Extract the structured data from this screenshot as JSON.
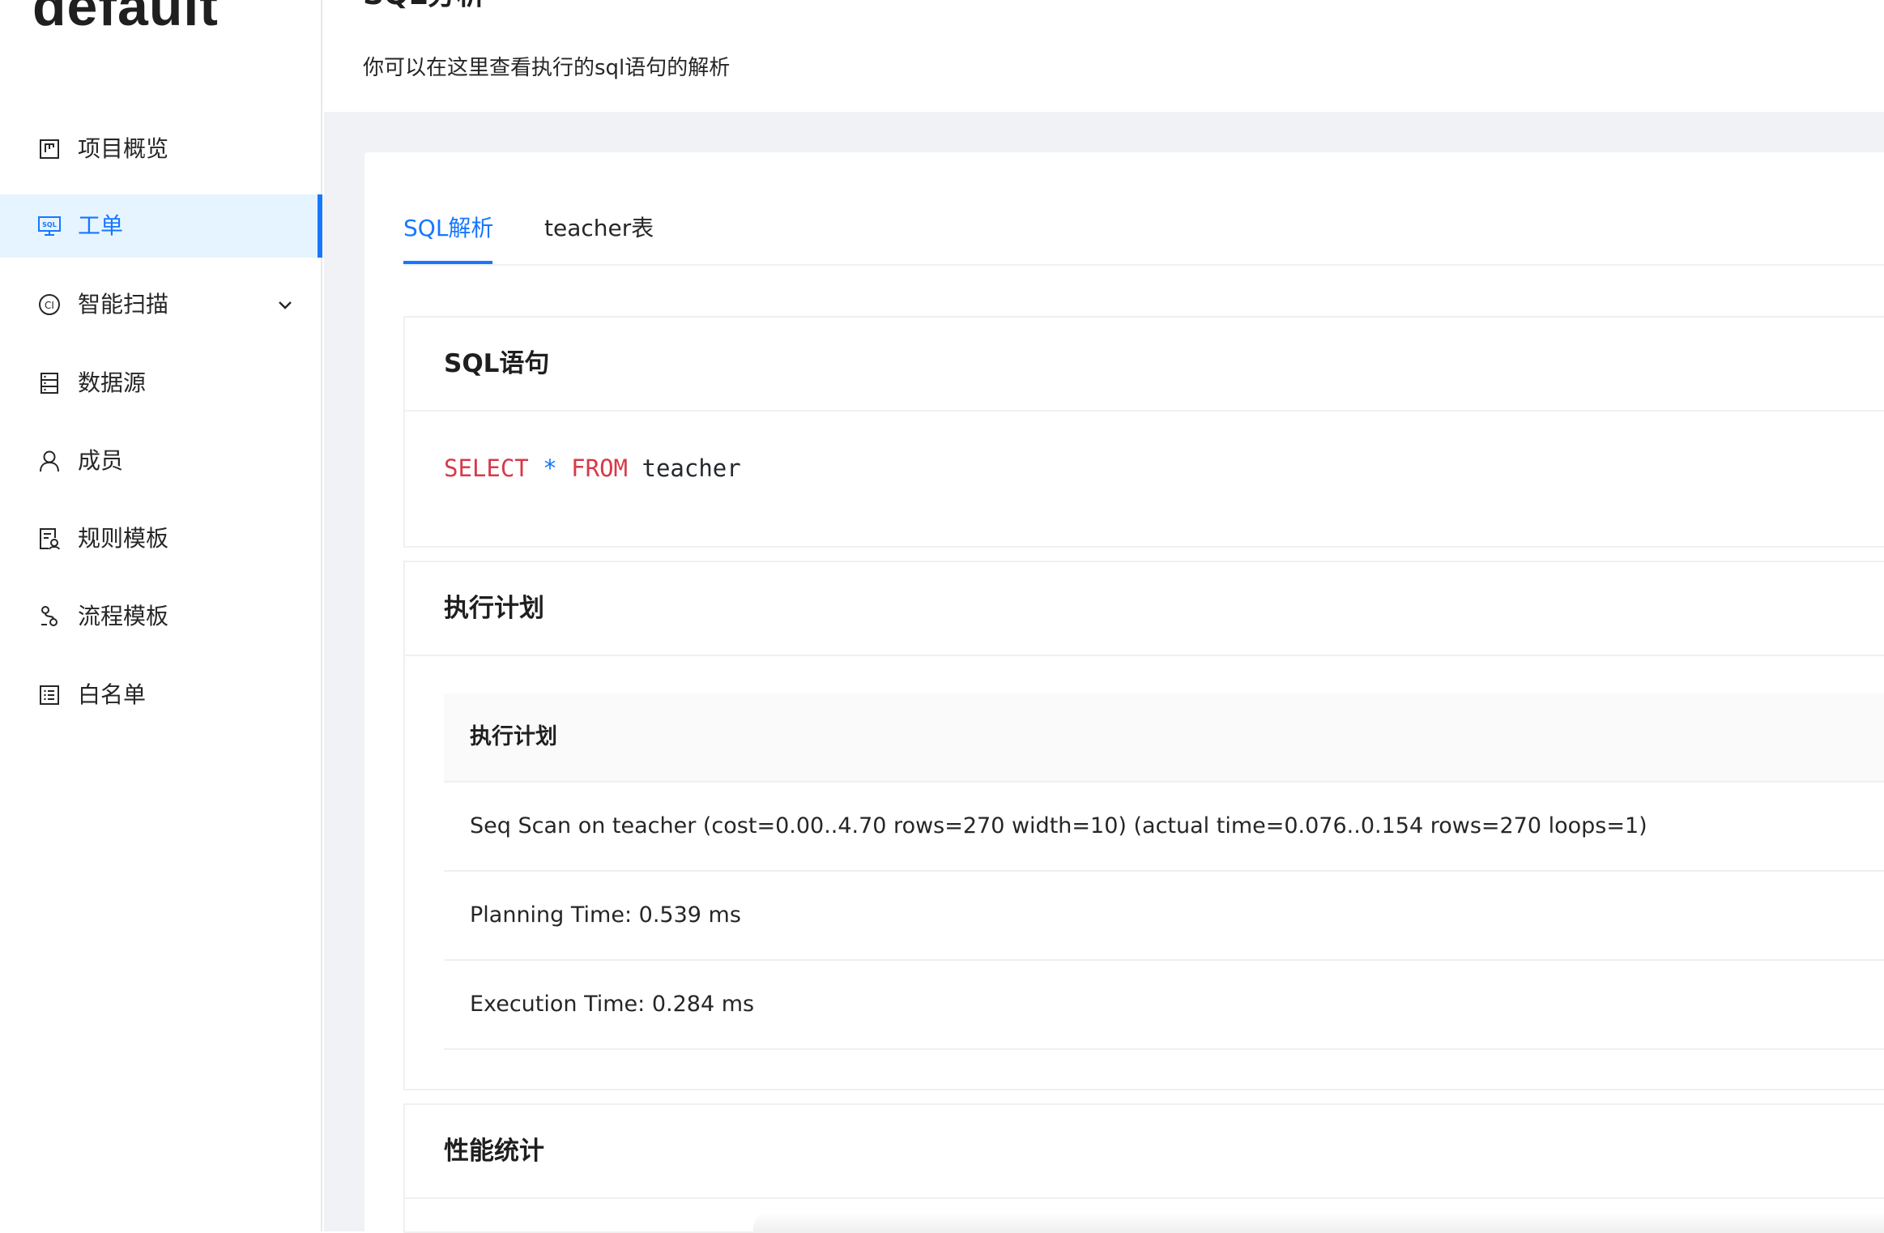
{
  "sidebar": {
    "project_name": "default",
    "items": [
      {
        "label": "项目概览",
        "icon": "project-overview-icon"
      },
      {
        "label": "工单",
        "icon": "sql-order-icon",
        "active": true
      },
      {
        "label": "智能扫描",
        "icon": "ci-scan-icon",
        "expandable": true
      },
      {
        "label": "数据源",
        "icon": "datasource-icon"
      },
      {
        "label": "成员",
        "icon": "user-icon"
      },
      {
        "label": "规则模板",
        "icon": "rule-template-icon"
      },
      {
        "label": "流程模板",
        "icon": "process-template-icon"
      },
      {
        "label": "白名单",
        "icon": "whitelist-icon"
      }
    ]
  },
  "header": {
    "title": "SQL分析",
    "description": "你可以在这里查看执行的sql语句的解析"
  },
  "tabs": [
    {
      "label": "SQL解析",
      "active": true
    },
    {
      "label": "teacher表",
      "active": false
    }
  ],
  "sql_panel": {
    "title": "SQL语句",
    "tokens": {
      "select": "SELECT",
      "star": "*",
      "from": "FROM",
      "table": "teacher"
    }
  },
  "plan_panel": {
    "title": "执行计划",
    "table_header": "执行计划",
    "rows": [
      "Seq Scan on teacher (cost=0.00..4.70 rows=270 width=10) (actual time=0.076..0.154 rows=270 loops=1)",
      "Planning Time: 0.539 ms",
      "Execution Time: 0.284 ms"
    ]
  },
  "perf_panel": {
    "title": "性能统计"
  },
  "colors": {
    "accent": "#1677ff",
    "active_bg": "#e6f4ff",
    "sql_keyword": "#d73a49",
    "page_bg": "#f0f2f5"
  }
}
